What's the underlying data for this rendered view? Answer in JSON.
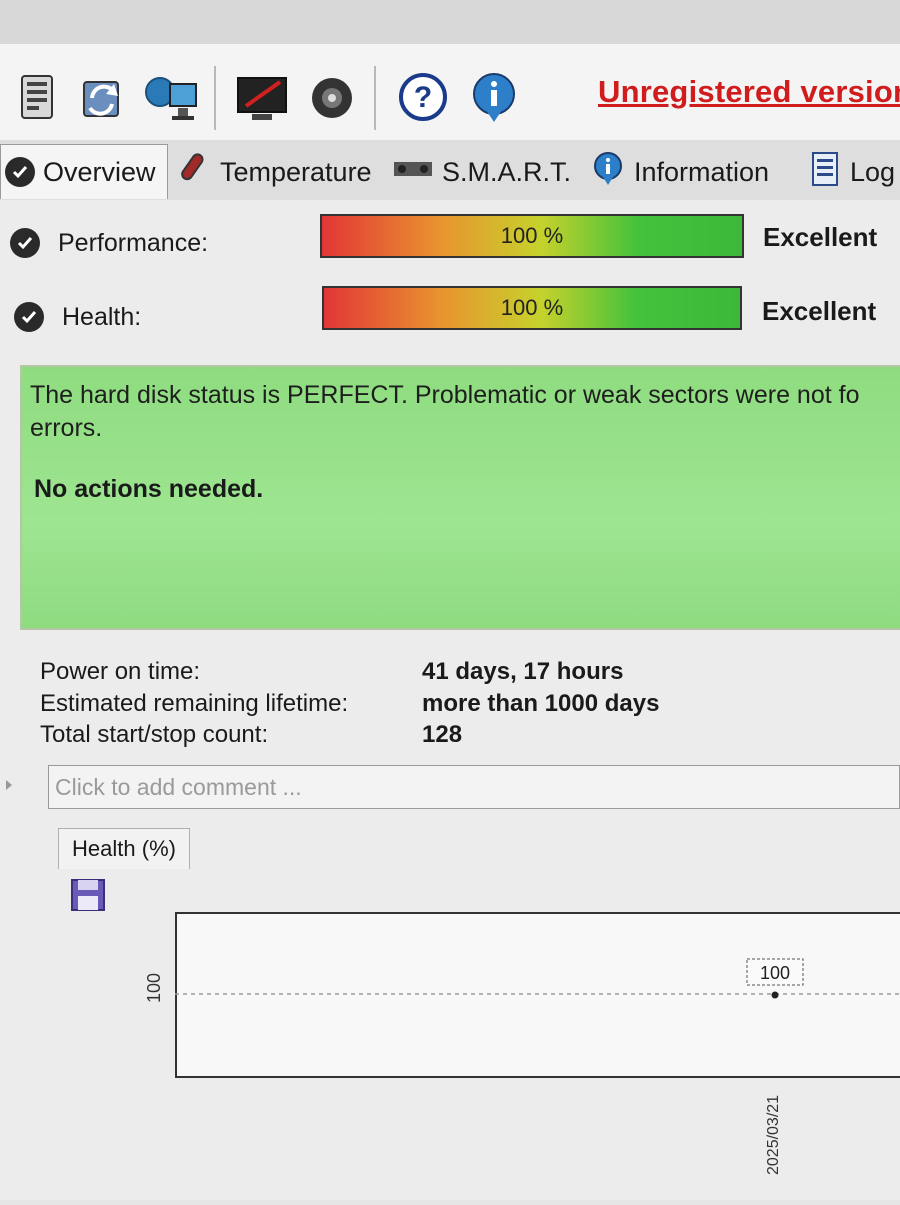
{
  "toolbar": {
    "icons": [
      "disk-info-icon",
      "refresh-icon",
      "network-icon",
      "monitor-icon",
      "speaker-icon",
      "help-icon",
      "info-icon"
    ],
    "unregistered_label": "Unregistered version"
  },
  "tabs": [
    {
      "label": "Overview",
      "icon": "check-icon",
      "active": true
    },
    {
      "label": "Temperature",
      "icon": "thermometer-icon",
      "active": false
    },
    {
      "label": "S.M.A.R.T.",
      "icon": "smart-icon",
      "active": false
    },
    {
      "label": "Information",
      "icon": "info-icon",
      "active": false
    },
    {
      "label": "Log",
      "icon": "log-icon",
      "active": false
    }
  ],
  "performance": {
    "label": "Performance:",
    "value": "100 %",
    "percent": 100,
    "rating": "Excellent"
  },
  "health": {
    "label": "Health:",
    "value": "100 %",
    "percent": 100,
    "rating": "Excellent"
  },
  "status": {
    "message": "The hard disk status is PERFECT. Problematic or weak sectors were not fo errors.",
    "action": "No actions needed."
  },
  "info": [
    {
      "label": "Power on time:",
      "value": "41 days, 17 hours"
    },
    {
      "label": "Estimated remaining lifetime:",
      "value": "more than 1000 days"
    },
    {
      "label": "Total start/stop count:",
      "value": "128"
    }
  ],
  "comment": {
    "placeholder": "Click to add comment ..."
  },
  "health_chart": {
    "tab_label": "Health (%)",
    "chart_data": {
      "type": "line",
      "x": [
        "2025/03/21"
      ],
      "series": [
        {
          "values": [
            100
          ]
        }
      ],
      "ytick": "100",
      "point_label": "100",
      "xtick": "2025/03/21"
    }
  },
  "colors": {
    "accent_red": "#d01c1c",
    "status_green": "#9ee591"
  }
}
